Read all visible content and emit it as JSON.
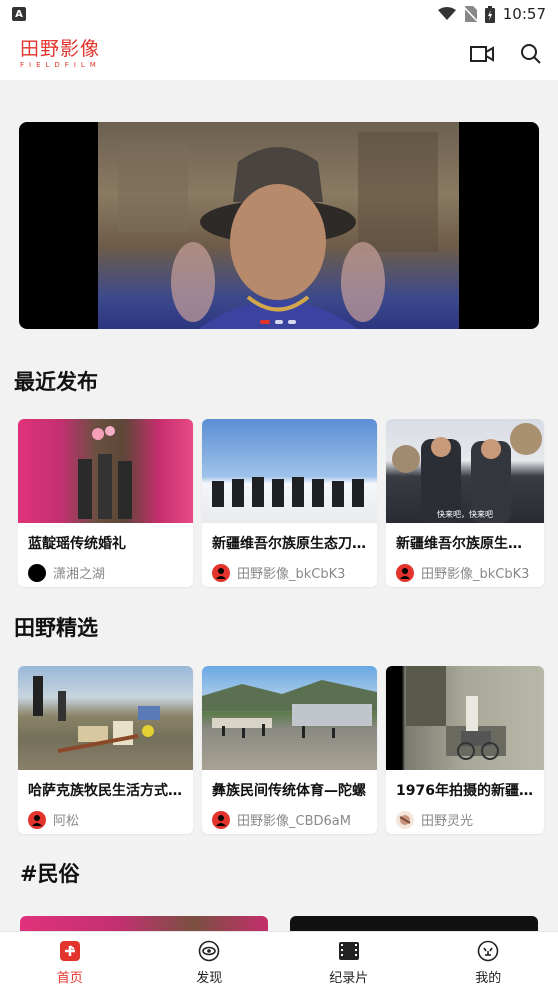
{
  "status_bar": {
    "time": "10:57"
  },
  "header": {
    "logo_main": "田野影像",
    "logo_sub": "FIELDFILM"
  },
  "banner": {
    "slides": 3,
    "active_slide": 1
  },
  "recent": {
    "title": "最近发布",
    "cards": [
      {
        "title": "蓝靛瑶传统婚礼",
        "author": "潇湘之湖"
      },
      {
        "title": "新疆维吾尔族原生态刀...",
        "author": "田野影像_bkCbK3"
      },
      {
        "title": "新疆维吾尔族原生态刀...",
        "author": "田野影像_bkCbK3",
        "thumb_caption": "快来吧，快来吧"
      }
    ]
  },
  "featured": {
    "title": "田野精选",
    "cards": [
      {
        "title": "哈萨克族牧民生活方式...",
        "author": "阿松"
      },
      {
        "title": "彝族民间传统体育—陀螺",
        "author": "田野影像_CBD6aM"
      },
      {
        "title": "1976年拍摄的新疆库车...",
        "author": "田野灵光"
      }
    ]
  },
  "folk": {
    "title": "#民俗"
  },
  "bottom_nav": [
    {
      "label": "首页",
      "icon": "home-icon",
      "active": true
    },
    {
      "label": "发现",
      "icon": "discover-icon",
      "active": false
    },
    {
      "label": "纪录片",
      "icon": "film-icon",
      "active": false
    },
    {
      "label": "我的",
      "icon": "profile-icon",
      "active": false
    }
  ],
  "colors": {
    "brand": "#e2342c"
  }
}
